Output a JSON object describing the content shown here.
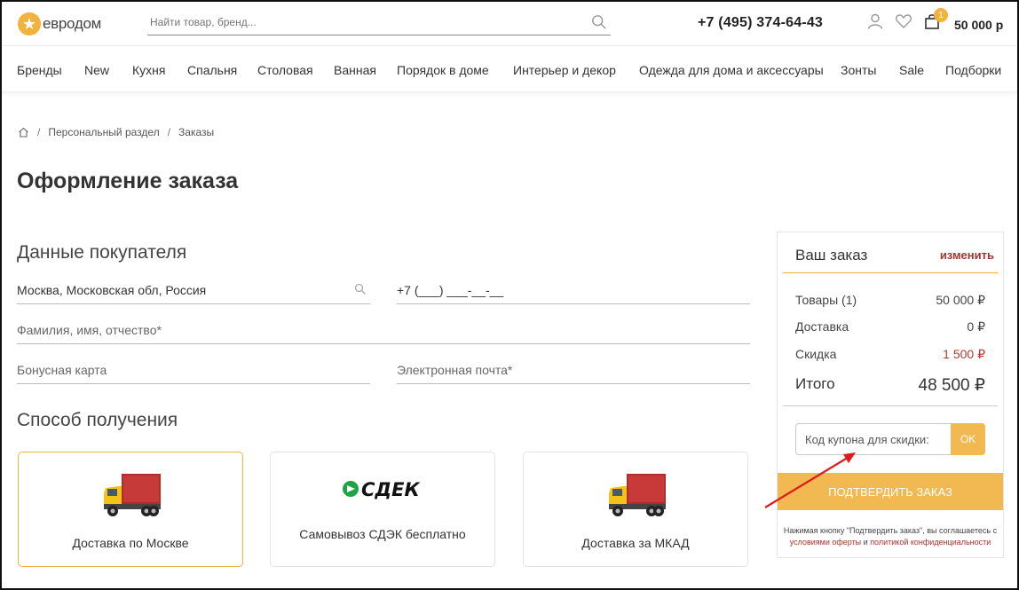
{
  "header": {
    "logo_text": "евродом",
    "search_placeholder": "Найти товар, бренд...",
    "phone": "+7 (495) 374-64-43",
    "cart_count": "1",
    "cart_total": "50 000 р"
  },
  "nav": {
    "items": [
      "Бренды",
      "New",
      "Кухня",
      "Спальня",
      "Столовая",
      "Ванная",
      "Порядок в доме",
      "Интерьер и декор",
      "Одежда для дома и аксессуары",
      "Зонты",
      "Sale",
      "Подборки"
    ]
  },
  "breadcrumb": [
    "Персональный раздел",
    "Заказы"
  ],
  "page_title": "Оформление заказа",
  "customer": {
    "title": "Данные покупателя",
    "city_value": "Москва, Московская обл, Россия",
    "phone_value": "+7 (___) ___-__-__",
    "name_placeholder": "Фамилия, имя, отчество*",
    "bonus_placeholder": "Бонусная карта",
    "email_placeholder": "Электронная почта*"
  },
  "delivery": {
    "title": "Способ получения",
    "options": [
      {
        "label": "Доставка по Москве",
        "icon": "truck-icon"
      },
      {
        "label": "Самовывоз СДЭК бесплатно",
        "icon": "cdek-logo",
        "logo_text": "СДЕК"
      },
      {
        "label": "Доставка за МКАД",
        "icon": "truck-icon"
      }
    ]
  },
  "order": {
    "title": "Ваш заказ",
    "edit": "изменить",
    "goods_label": "Товары (1)",
    "goods_value": "50 000 ₽",
    "delivery_label": "Доставка",
    "delivery_value": "0 ₽",
    "discount_label": "Скидка",
    "discount_value": "1 500 ₽",
    "total_label": "Итого",
    "total_value": "48 500 ₽",
    "coupon_placeholder": "Код купона для скидки:",
    "coupon_button": "OK",
    "confirm_button": "ПОДТВЕРДИТЬ ЗАКАЗ",
    "note_prefix": "Нажимая кнопку \"Подтвердить заказ\", вы соглашаетесь с",
    "note_link1": "условиями оферты",
    "note_and": " и ",
    "note_link2": "политикой конфиденциальности"
  },
  "colors": {
    "accent": "#f2b33d",
    "button": "#f2b852",
    "link_red": "#a5352e",
    "annotation_arrow": "#e01b1b"
  }
}
